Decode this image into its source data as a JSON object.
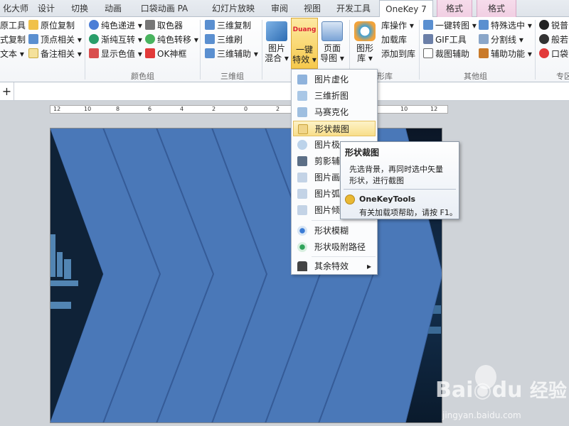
{
  "tabs": {
    "t0": "化大师",
    "t1": "设计",
    "t2": "切换",
    "t3": "动画",
    "t4": "口袋动画 PA",
    "t5": "幻灯片放映",
    "t6": "审阅",
    "t7": "视图",
    "t8": "开发工具",
    "t9": "OneKey 7",
    "t10": "格式",
    "t11": "格式"
  },
  "ribbon": {
    "c1": [
      "原工具",
      "式复制",
      "文本"
    ],
    "c2": [
      "原位复制",
      "顶点相关",
      "备注相关"
    ],
    "c3": [
      "纯色递进",
      "渐纯互转",
      "显示色值"
    ],
    "c4": [
      "取色器",
      "纯色转移",
      "OK神框"
    ],
    "c5": [
      "三维复制",
      "三维刷",
      "三维辅助"
    ],
    "big1": [
      "图片",
      "混合"
    ],
    "big2": [
      "一键",
      "特效"
    ],
    "big2_logo": "Duang",
    "big3": [
      "页面",
      "导图"
    ],
    "big4": [
      "图形",
      "库"
    ],
    "c6": [
      "库操作",
      "加载库",
      "添加到库"
    ],
    "c7": [
      "一键转图",
      "GIF工具",
      "裁图辅助"
    ],
    "c8": [
      "特殊选中",
      "分割线",
      "辅助功能"
    ],
    "c9": [
      "锐普",
      "般若",
      "口袋"
    ],
    "groups": {
      "g1": "颜色组",
      "g2": "三维组",
      "g3": "形库",
      "g4": "其他组",
      "g5": "专区"
    }
  },
  "menu": {
    "items": [
      "图片虚化",
      "三维折图",
      "马赛克化",
      "形状裁图",
      "图片极",
      "剪影辅助",
      "图片画",
      "图片弧",
      "图片倾",
      "形状模糊",
      "形状吸附路径",
      "其余特效"
    ],
    "arrow": "▸"
  },
  "tooltip": {
    "title": "形状裁图",
    "line1": "先选背景，再同时选中矢量",
    "line2": "形状，进行截图",
    "addin": "OneKeyTools",
    "help": "有关加载项帮助，请按 F1。"
  },
  "ruler": {
    "ticks": [
      "12",
      "10",
      "8",
      "6",
      "4",
      "2",
      "0",
      "2",
      "4",
      "6",
      "8",
      "10",
      "12"
    ]
  },
  "watermark": {
    "brand1": "Bai",
    "brand2": "du",
    "brand3": "经验",
    "url": "jingyan.baidu.com"
  },
  "formula": {
    "plus": "+"
  },
  "colors": {
    "accent_tab": "#f5c242",
    "shape_fill": "#4a78b8",
    "menu_highlight": "#fbe8a6",
    "context_tab": "#f3d3e6"
  }
}
